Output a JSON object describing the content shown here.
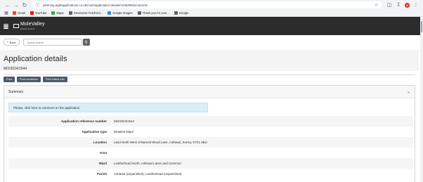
{
  "browser": {
    "url": "planning.agileapplications.co.uk/mole/application-details/120629#documents",
    "bookmarks": [
      {
        "label": "Gmail",
        "color": "#ea4335"
      },
      {
        "label": "YouTube",
        "color": "#ff0000"
      },
      {
        "label": "Maps",
        "color": "#34a853"
      },
      {
        "label": "Greenview Fetch'eni...",
        "color": "#5f6368"
      },
      {
        "label": "Google Images",
        "color": "#4285f4"
      },
      {
        "label": "Thank you for yoor...",
        "color": "#5f6368"
      },
      {
        "label": "Google",
        "color": "#5f6368"
      }
    ],
    "avatar_letter": "G"
  },
  "site": {
    "logo_text": "MoleValley",
    "logo_sub": "District Council"
  },
  "toolbar": {
    "back_label": "Back",
    "search_placeholder": "Quick search"
  },
  "page": {
    "title": "Application details",
    "reference": "MO/2024/1544",
    "buttons": {
      "print": "Print",
      "print_conditions": "Print conditions",
      "print_further_info": "Print further info"
    }
  },
  "summary": {
    "title": "Summary",
    "comment_text": "Please, click here to comment on the application",
    "rows": [
      {
        "label": "Application reference number",
        "value": "MO/2024/1544"
      },
      {
        "label": "Application type",
        "value": "Detailed Major"
      },
      {
        "label": "Location",
        "value": "Land North West of Barnett Wood Lane, Ashtead, Surrey, KT21 2BU"
      },
      {
        "label": "Area",
        "value": ""
      },
      {
        "label": "Ward",
        "value": "Leatherhead North, Ashtead Lanes and Common"
      },
      {
        "label": "Parish",
        "value": "Ashtead (Unparished), Leatherhead (Unparished)"
      }
    ]
  },
  "colors": {
    "header_bg": "#2c2c2c",
    "button_bg": "#4a5a6a",
    "banner_bg": "#d9eef7"
  }
}
